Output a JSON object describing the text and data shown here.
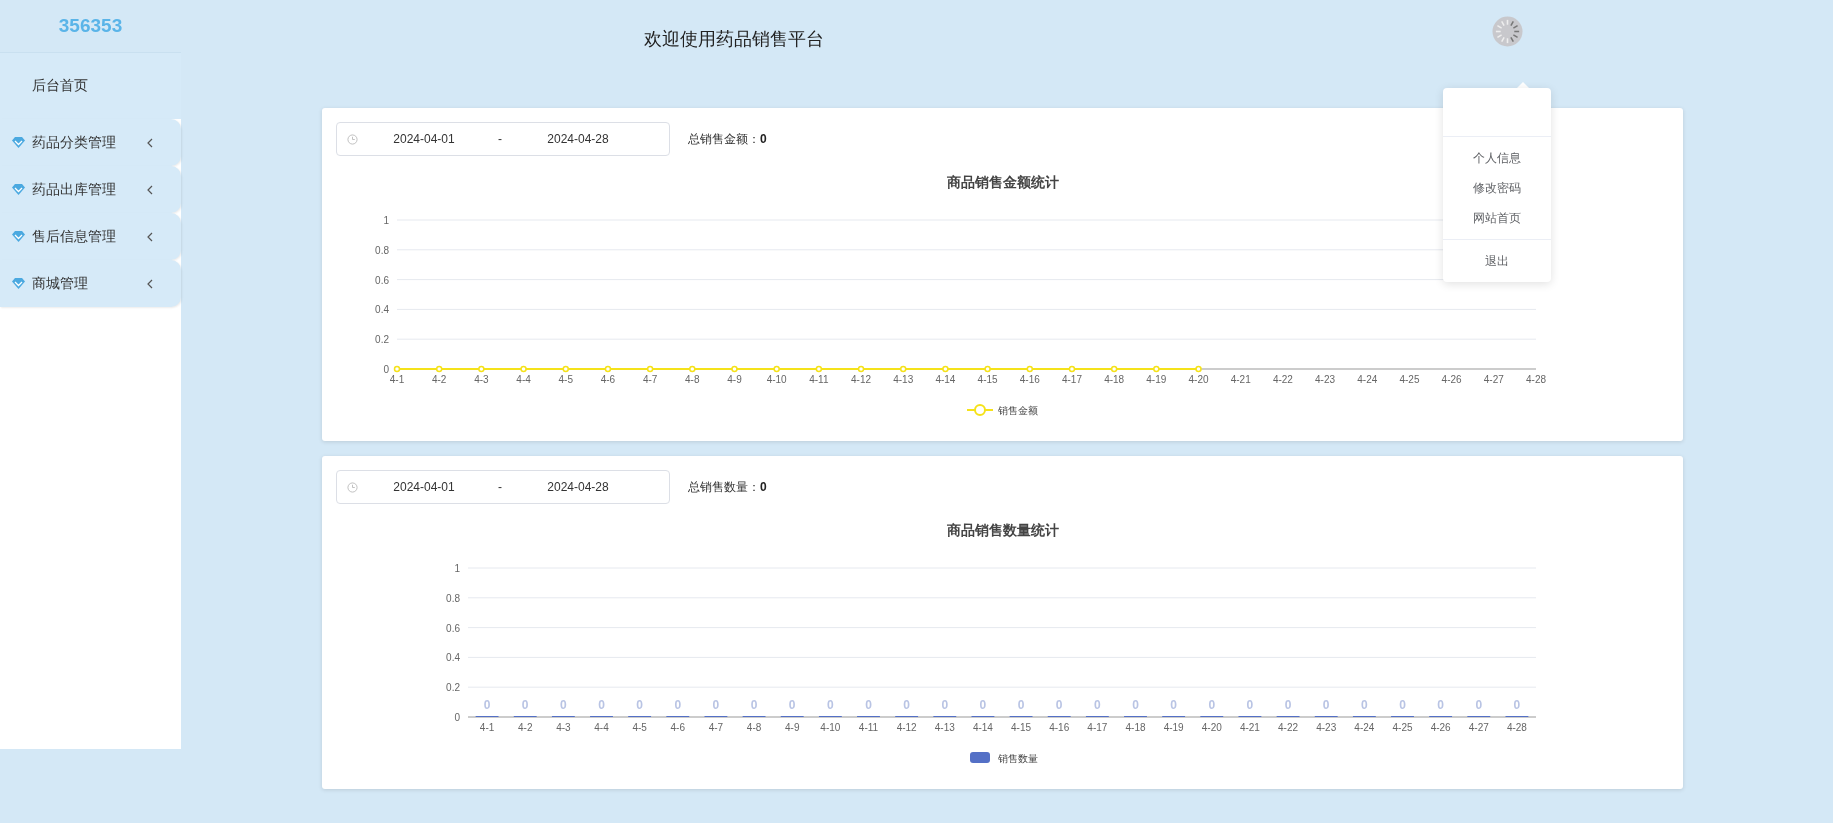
{
  "sidebar": {
    "brand": "356353",
    "items": [
      {
        "label": "后台首页",
        "kind": "link"
      },
      {
        "label": "药品分类管理",
        "kind": "menu"
      },
      {
        "label": "药品出库管理",
        "kind": "menu"
      },
      {
        "label": "售后信息管理",
        "kind": "menu"
      },
      {
        "label": "商城管理",
        "kind": "menu"
      }
    ]
  },
  "header": {
    "title": "欢迎使用药品销售平台"
  },
  "user_menu": {
    "sections": [
      [
        "个人信息",
        "修改密码",
        "网站首页"
      ],
      [
        "退出"
      ]
    ]
  },
  "cards": [
    {
      "date_range": {
        "start": "2024-04-01",
        "separator": "-",
        "end": "2024-04-28"
      },
      "total_label": "总销售金额：",
      "total_value": "0",
      "chart_data": {
        "type": "line",
        "title": "商品销售金额统计",
        "grid": true,
        "categories": [
          "4-1",
          "4-2",
          "4-3",
          "4-4",
          "4-5",
          "4-6",
          "4-7",
          "4-8",
          "4-9",
          "4-10",
          "4-11",
          "4-12",
          "4-13",
          "4-14",
          "4-15",
          "4-16",
          "4-17",
          "4-18",
          "4-19",
          "4-20",
          "4-21",
          "4-22",
          "4-23",
          "4-24",
          "4-25",
          "4-26",
          "4-27",
          "4-28"
        ],
        "ylim": [
          0,
          1
        ],
        "yticks": [
          0,
          0.2,
          0.4,
          0.6,
          0.8,
          1
        ],
        "series": [
          {
            "name": "销售金额",
            "color": "#f5e21a",
            "marker": true,
            "values": [
              0,
              0,
              0,
              0,
              0,
              0,
              0,
              0,
              0,
              0,
              0,
              0,
              0,
              0,
              0,
              0,
              0,
              0,
              0,
              0,
              null,
              null,
              null,
              null,
              null,
              null,
              null,
              null
            ]
          }
        ]
      }
    },
    {
      "date_range": {
        "start": "2024-04-01",
        "separator": "-",
        "end": "2024-04-28"
      },
      "total_label": "总销售数量：",
      "total_value": "0",
      "chart_data": {
        "type": "bar",
        "title": "商品销售数量统计",
        "grid": true,
        "categories": [
          "4-1",
          "4-2",
          "4-3",
          "4-4",
          "4-5",
          "4-6",
          "4-7",
          "4-8",
          "4-9",
          "4-10",
          "4-11",
          "4-12",
          "4-13",
          "4-14",
          "4-15",
          "4-16",
          "4-17",
          "4-18",
          "4-19",
          "4-20",
          "4-21",
          "4-22",
          "4-23",
          "4-24",
          "4-25",
          "4-26",
          "4-27",
          "4-28"
        ],
        "ylim": [
          0,
          1
        ],
        "yticks": [
          0,
          0.2,
          0.4,
          0.6,
          0.8,
          1
        ],
        "data_labels": true,
        "series": [
          {
            "name": "销售数量",
            "color": "#5470c6",
            "values": [
              0,
              0,
              0,
              0,
              0,
              0,
              0,
              0,
              0,
              0,
              0,
              0,
              0,
              0,
              0,
              0,
              0,
              0,
              0,
              0,
              0,
              0,
              0,
              0,
              0,
              0,
              0,
              0
            ]
          }
        ]
      }
    }
  ]
}
